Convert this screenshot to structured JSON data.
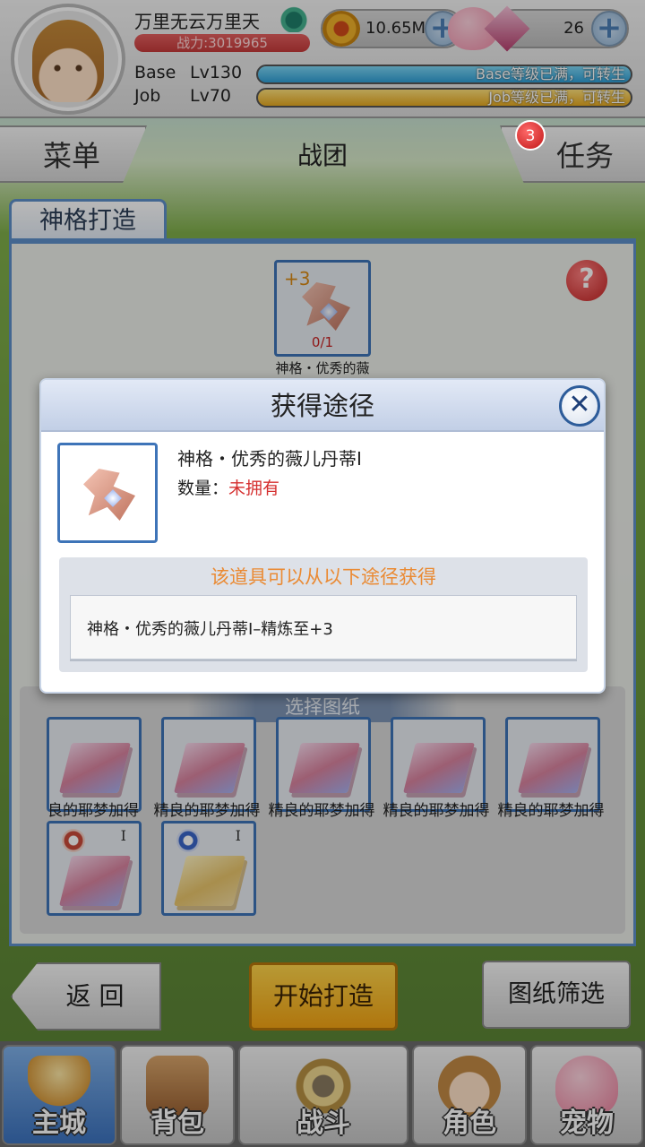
{
  "player": {
    "name": "万里无云万里天",
    "power": "战力:3019965",
    "base_label": "Base",
    "base_level": "Lv130",
    "base_status": "Base等级已满，可转生",
    "job_label": "Job",
    "job_level": "Lv70",
    "job_status": "Job等级已满，可转生"
  },
  "currency": {
    "zeny": "10.65M",
    "gems": "26",
    "plus": "+"
  },
  "nav": {
    "menu": "菜单",
    "title": "战团",
    "task": "任务",
    "task_badge": "3"
  },
  "panel": {
    "tab": "神格打造",
    "target_plus": "+3",
    "target_count": "0/1",
    "target_name": "神格・优秀的薇",
    "help": "?",
    "blueprint_title": "选择图纸",
    "blueprints": [
      {
        "name": "良的耶梦加得"
      },
      {
        "name": "精良的耶梦加得"
      },
      {
        "name": "精良的耶梦加得"
      },
      {
        "name": "精良的耶梦加得"
      },
      {
        "name": "精良的耶梦加得"
      }
    ],
    "blueprint_numeral": "I"
  },
  "buttons": {
    "back": "返 回",
    "start": "开始打造",
    "filter": "图纸筛选"
  },
  "tabs": [
    "主城",
    "背包",
    "战斗",
    "角色",
    "宠物"
  ],
  "modal": {
    "title": "获得途径",
    "close": "✕",
    "item_name": "神格・优秀的薇儿丹蒂I",
    "qty_label": "数量：",
    "qty_value": "未拥有",
    "source_heading": "该道具可以从以下途径获得",
    "source_row": "神格・优秀的薇儿丹蒂I–精炼至+3"
  },
  "colors": {
    "accent_blue": "#3e74b8",
    "start_button": "#f3a414",
    "warning_red": "#d53030",
    "source_heading": "#ea8a33"
  }
}
